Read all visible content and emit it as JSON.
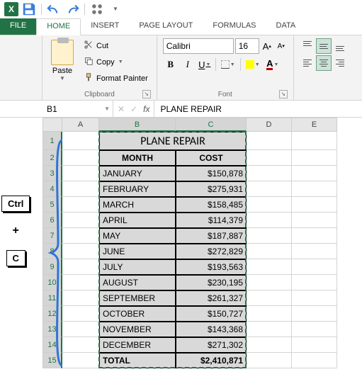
{
  "qat": {
    "logo": "X"
  },
  "tabs": {
    "file": "FILE",
    "home": "HOME",
    "insert": "INSERT",
    "page_layout": "PAGE LAYOUT",
    "formulas": "FORMULAS",
    "data": "DATA"
  },
  "ribbon": {
    "clipboard": {
      "paste": "Paste",
      "cut": "Cut",
      "copy": "Copy",
      "format_painter": "Format Painter",
      "label": "Clipboard"
    },
    "font": {
      "name": "Calibri",
      "size": "16",
      "increase": "A",
      "decrease": "A",
      "bold": "B",
      "italic": "I",
      "underline": "U",
      "font_color_glyph": "A",
      "label": "Font"
    }
  },
  "formula_bar": {
    "name_box": "B1",
    "cancel": "✕",
    "enter": "✓",
    "fx": "fx",
    "value": "PLANE REPAIR"
  },
  "columns": {
    "A": "A",
    "B": "B",
    "C": "C",
    "D": "D",
    "E": "E"
  },
  "table": {
    "title": "PLANE REPAIR",
    "headers": {
      "month": "MONTH",
      "cost": "COST"
    },
    "rows": [
      {
        "month": "JANUARY",
        "cost": "$150,878"
      },
      {
        "month": "FEBRUARY",
        "cost": "$275,931"
      },
      {
        "month": "MARCH",
        "cost": "$158,485"
      },
      {
        "month": "APRIL",
        "cost": "$114,379"
      },
      {
        "month": "MAY",
        "cost": "$187,887"
      },
      {
        "month": "JUNE",
        "cost": "$272,829"
      },
      {
        "month": "JULY",
        "cost": "$193,563"
      },
      {
        "month": "AUGUST",
        "cost": "$230,195"
      },
      {
        "month": "SEPTEMBER",
        "cost": "$261,327"
      },
      {
        "month": "OCTOBER",
        "cost": "$150,727"
      },
      {
        "month": "NOVEMBER",
        "cost": "$143,368"
      },
      {
        "month": "DECEMBER",
        "cost": "$271,302"
      }
    ],
    "total": {
      "label": "TOTAL",
      "value": "$2,410,871"
    }
  },
  "keys": {
    "ctrl": "Ctrl",
    "plus": "+",
    "c": "C"
  }
}
